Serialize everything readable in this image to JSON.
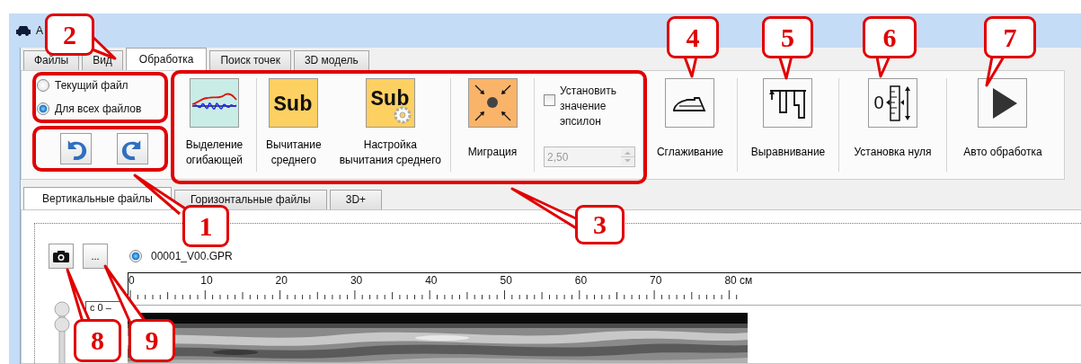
{
  "window": {
    "title": "A"
  },
  "tabs": [
    {
      "label": "Файлы",
      "selected": false
    },
    {
      "label": "Вид",
      "selected": false
    },
    {
      "label": "Обработка",
      "selected": true
    },
    {
      "label": "Поиск точек",
      "selected": false
    },
    {
      "label": "3D модель",
      "selected": false
    }
  ],
  "apply_scope": [
    {
      "label": "Текущий файл",
      "selected": false
    },
    {
      "label": "Для всех файлов",
      "selected": true
    }
  ],
  "history_buttons": [
    {
      "kind": "undo"
    },
    {
      "kind": "redo"
    }
  ],
  "ribbon_groups": [
    {
      "items": [
        {
          "kind": "envelope",
          "lines": [
            "Выделение",
            "огибающей"
          ]
        }
      ]
    },
    {
      "items": [
        {
          "kind": "sub",
          "icon_text": "Sub",
          "lines": [
            "Вычитание",
            "среднего"
          ]
        },
        {
          "kind": "sub_settings",
          "icon_text": "Sub",
          "lines": [
            "Настройка",
            "вычитания среднего"
          ]
        }
      ]
    },
    {
      "items": [
        {
          "kind": "migration",
          "lines": [
            "Миграция"
          ]
        }
      ]
    },
    {
      "items": [
        {
          "kind": "epsilon",
          "checkbox": {
            "lines": [
              "Установить",
              "значение",
              "эпсилон"
            ],
            "checked": false
          },
          "spin": {
            "value": "2,50",
            "disabled": true
          }
        }
      ]
    },
    {
      "items": [
        {
          "kind": "iron",
          "lines": [
            "Сглаживание"
          ]
        }
      ]
    },
    {
      "items": [
        {
          "kind": "leveling",
          "lines": [
            "Выравнивание"
          ]
        }
      ]
    },
    {
      "items": [
        {
          "kind": "zero",
          "icon_text": "0",
          "lines": [
            "Установка нуля"
          ]
        }
      ]
    },
    {
      "items": [
        {
          "kind": "play",
          "lines": [
            "Авто обработка"
          ]
        }
      ]
    }
  ],
  "sub_tabs": [
    {
      "label": "Вертикальные файлы",
      "selected": true
    },
    {
      "label": "Горизонтальные файлы",
      "selected": false
    },
    {
      "label": "3D+",
      "selected": false
    }
  ],
  "viewer": {
    "more_button": "...",
    "files": [
      {
        "label": "00001_V00.GPR",
        "selected": true
      }
    ],
    "ruler": {
      "labels": [
        "0",
        "10",
        "20",
        "30",
        "40",
        "50",
        "60",
        "70",
        "80"
      ],
      "unit": "см"
    },
    "depth_label": "с 0 –",
    "slider": {
      "level": 0
    }
  },
  "callouts": [
    {
      "label": "1"
    },
    {
      "label": "2"
    },
    {
      "label": "3"
    },
    {
      "label": "4"
    },
    {
      "label": "5"
    },
    {
      "label": "6"
    },
    {
      "label": "7"
    },
    {
      "label": "8"
    },
    {
      "label": "9"
    }
  ]
}
